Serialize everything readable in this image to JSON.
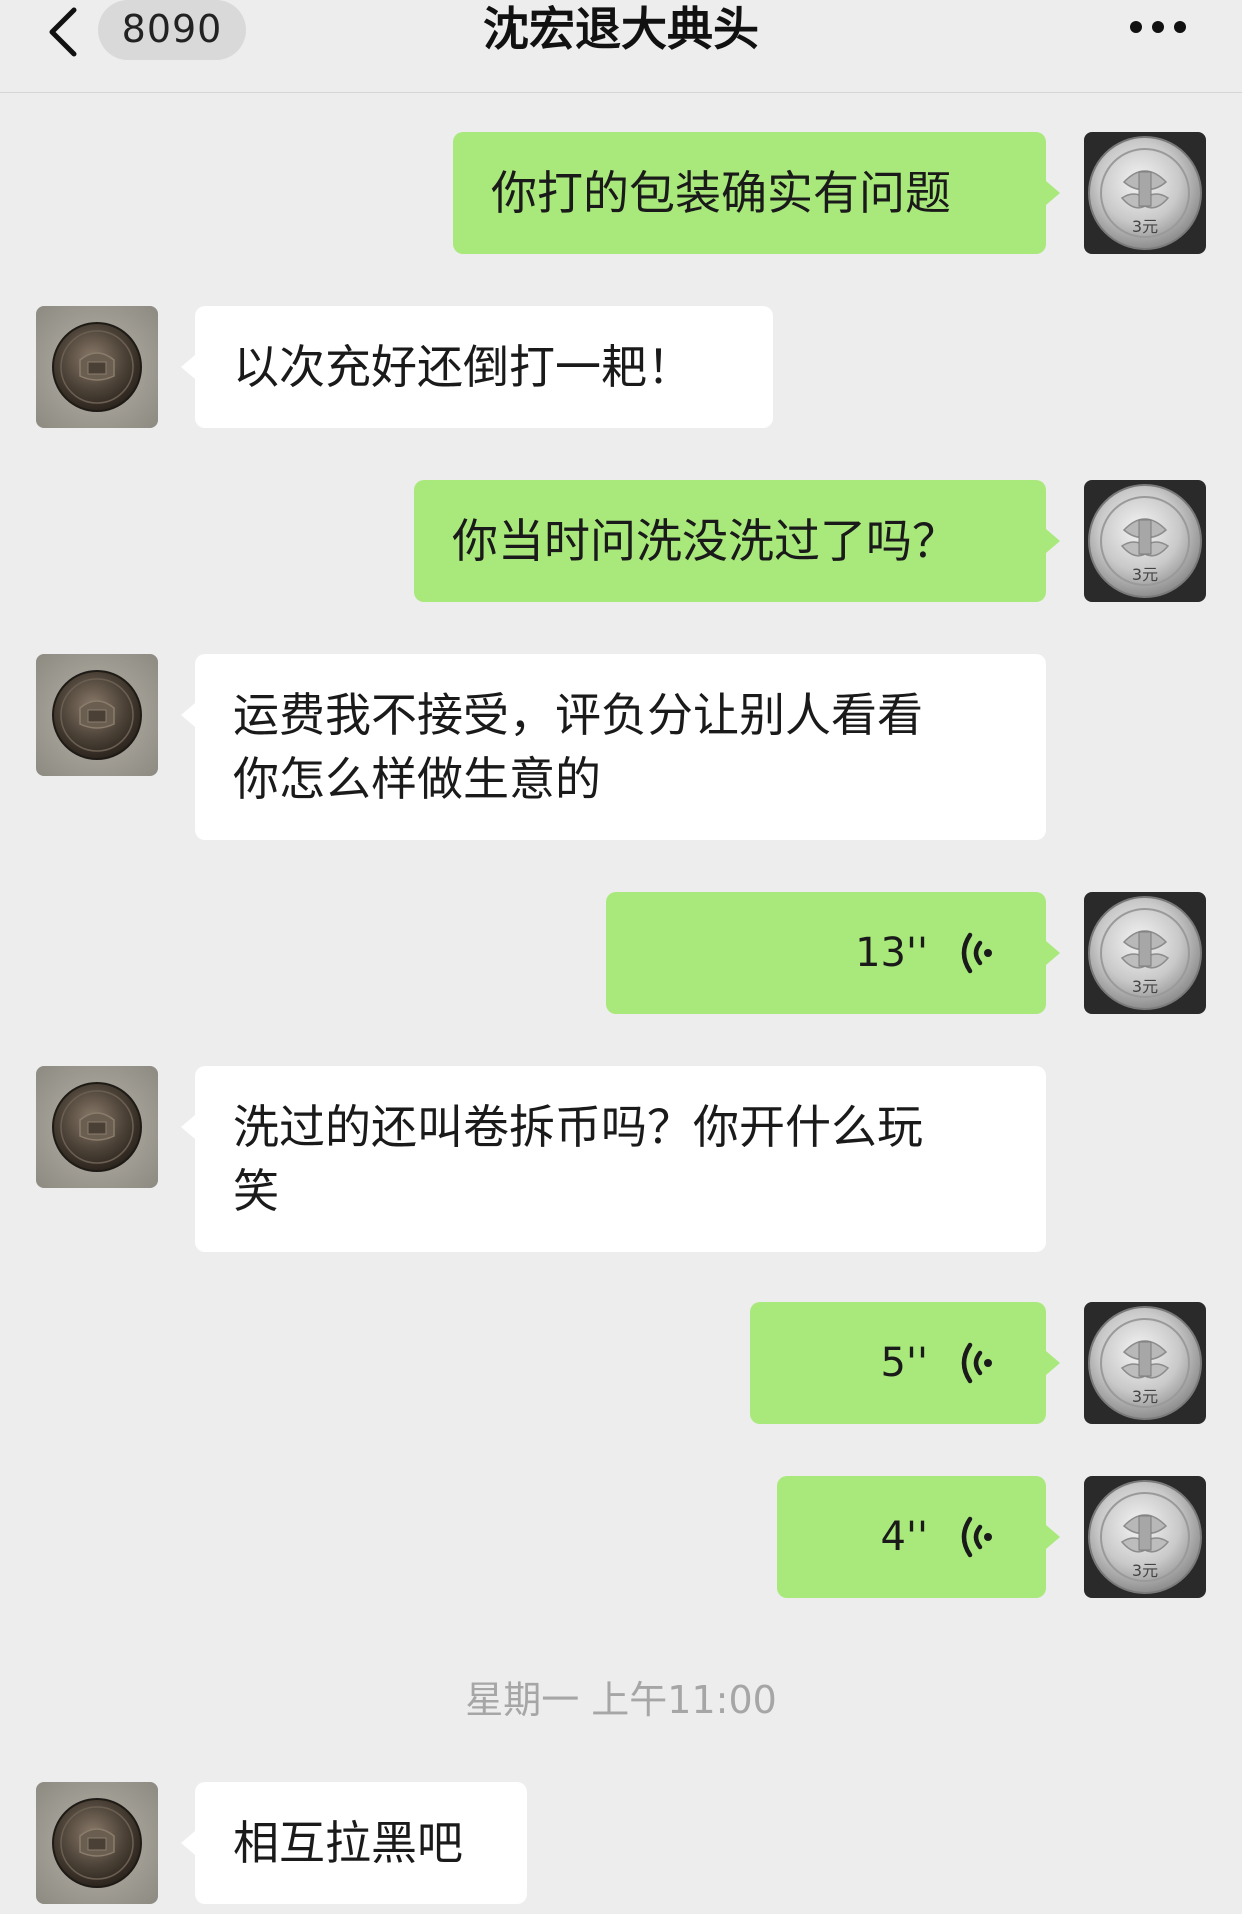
{
  "header": {
    "unread_count": "8090",
    "title": "沈宏退大典头"
  },
  "messages": [
    {
      "side": "right",
      "kind": "text",
      "text": "你打的包装确实有问题"
    },
    {
      "side": "left",
      "kind": "text",
      "text": "以次充好还倒打一耙！"
    },
    {
      "side": "right",
      "kind": "text",
      "text": "你当时问洗没洗过了吗？"
    },
    {
      "side": "left",
      "kind": "text",
      "lines": [
        "运费我不接受，评负分让别人看看",
        "你怎么样做生意的"
      ]
    },
    {
      "side": "right",
      "kind": "voice",
      "duration": "13''"
    },
    {
      "side": "left",
      "kind": "text",
      "lines": [
        "洗过的还叫卷拆币吗？你开什么玩",
        "笑"
      ]
    },
    {
      "side": "right",
      "kind": "voice",
      "duration": "5''"
    },
    {
      "side": "right",
      "kind": "voice",
      "duration": "4''"
    },
    {
      "side": "left",
      "kind": "text",
      "text": "相互拉黑吧"
    }
  ],
  "timestamp": "星期一 上午11:00",
  "avatar_labels": {
    "self": "3元"
  },
  "colors": {
    "background": "#ededed",
    "self_bubble": "#a9e97c",
    "other_bubble": "#ffffff",
    "timestamp_text": "#a6a6a6"
  },
  "icons": {
    "back": "chevron-left-icon",
    "more": "more-dots-icon",
    "voice": "voice-wave-icon"
  }
}
